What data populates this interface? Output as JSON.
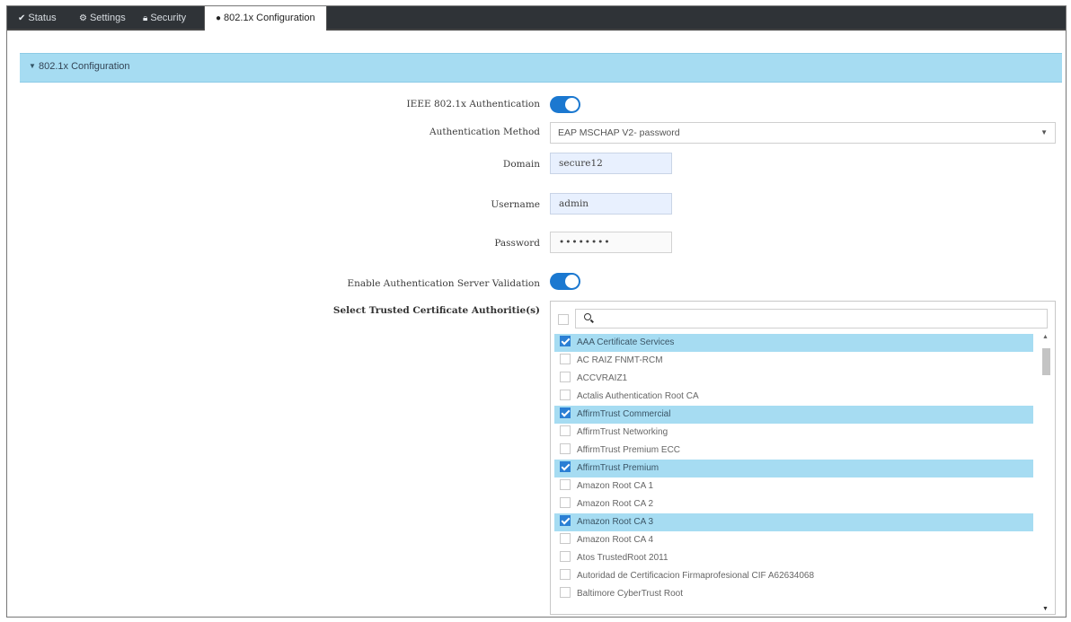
{
  "tabs": [
    {
      "label": "Status",
      "icon": "check-icon"
    },
    {
      "label": "Settings",
      "icon": "gear-icon"
    },
    {
      "label": "Security",
      "icon": "lock-icon"
    },
    {
      "label": "802.1x Configuration",
      "icon": "dot-icon",
      "active": true
    }
  ],
  "section": {
    "title": "802.1x Configuration"
  },
  "form": {
    "ieee_label": "IEEE 802.1x Authentication",
    "ieee_enabled": true,
    "method_label": "Authentication Method",
    "method_value": "EAP MSCHAP V2- password",
    "domain_label": "Domain",
    "domain_value": "secure12",
    "username_label": "Username",
    "username_value": "admin",
    "password_label": "Password",
    "password_value": "••••••••",
    "server_validation_label": "Enable Authentication Server Validation",
    "server_validation_enabled": true,
    "trusted_ca_label": "Select Trusted Certificate Authoritie(s)"
  },
  "certificates": [
    {
      "name": "AAA Certificate Services",
      "checked": true
    },
    {
      "name": "AC RAIZ FNMT-RCM",
      "checked": false
    },
    {
      "name": "ACCVRAIZ1",
      "checked": false
    },
    {
      "name": "Actalis Authentication Root CA",
      "checked": false
    },
    {
      "name": "AffirmTrust Commercial",
      "checked": true
    },
    {
      "name": "AffirmTrust Networking",
      "checked": false
    },
    {
      "name": "AffirmTrust Premium ECC",
      "checked": false
    },
    {
      "name": "AffirmTrust Premium",
      "checked": true
    },
    {
      "name": "Amazon Root CA 1",
      "checked": false
    },
    {
      "name": "Amazon Root CA 2",
      "checked": false
    },
    {
      "name": "Amazon Root CA 3",
      "checked": true
    },
    {
      "name": "Amazon Root CA 4",
      "checked": false
    },
    {
      "name": "Atos TrustedRoot 2011",
      "checked": false
    },
    {
      "name": "Autoridad de Certificacion Firmaprofesional CIF A62634068",
      "checked": false
    },
    {
      "name": "Baltimore CyberTrust Root",
      "checked": false
    }
  ],
  "colors": {
    "accent": "#1b78d0",
    "section_bg": "#a6dcf2",
    "tabbar_bg": "#2f3337"
  }
}
